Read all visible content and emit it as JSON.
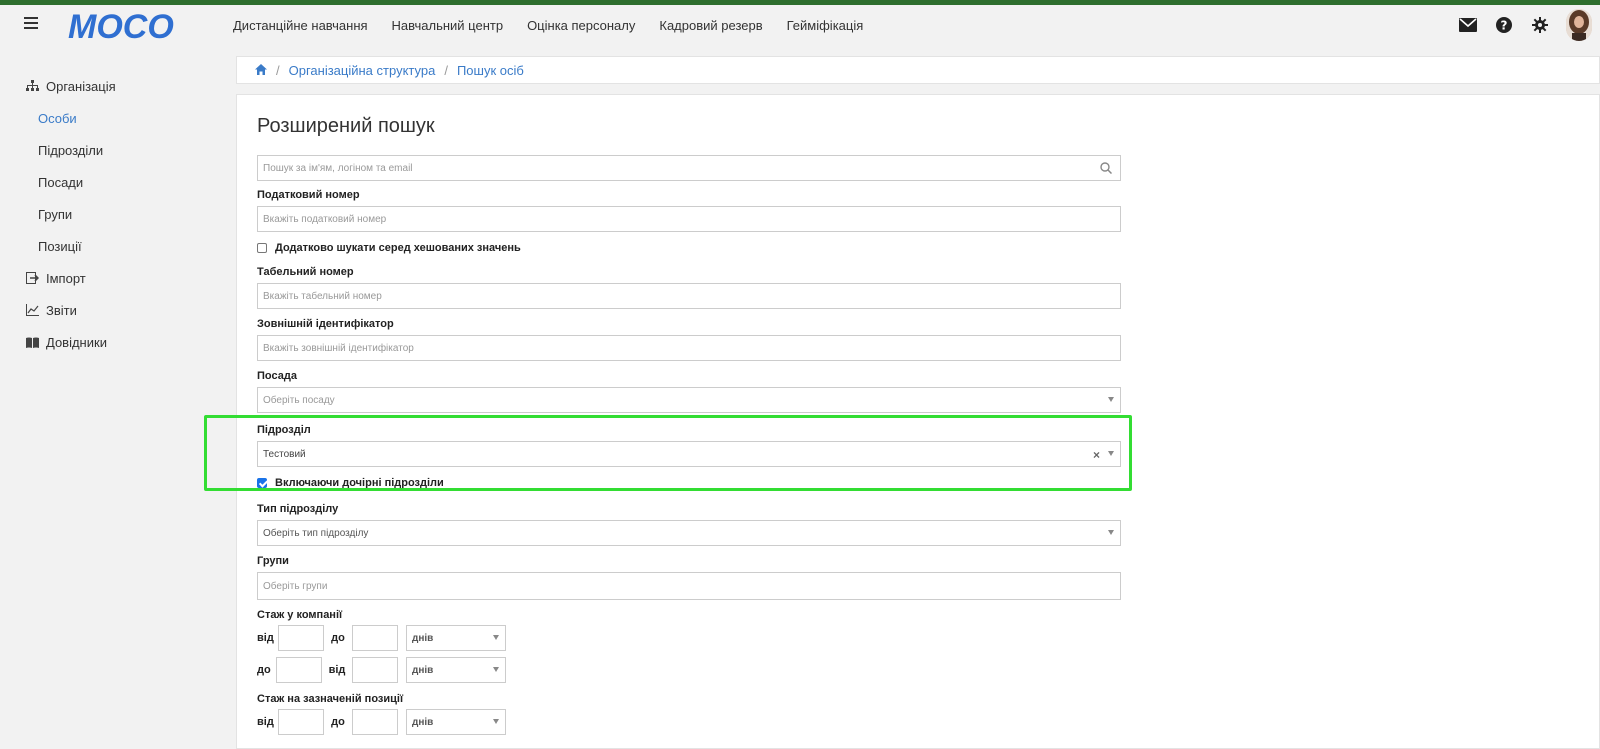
{
  "app": {
    "logo_text": "MOCO",
    "brand_color": "#2f6fd1",
    "stripe_color": "#2e6e2e",
    "accent_color": "#3a7bc8"
  },
  "topnav": {
    "items": [
      "Дистанційне навчання",
      "Навчальний центр",
      "Оцінка персоналу",
      "Кадровий резерв",
      "Гейміфікація"
    ]
  },
  "topicons": [
    "mail-icon",
    "help-icon",
    "gear-icon",
    "avatar"
  ],
  "sidebar": {
    "items": [
      {
        "label": "Організація",
        "icon": "org-chart-icon"
      },
      {
        "label": "Особи",
        "active": true
      },
      {
        "label": "Підрозділи"
      },
      {
        "label": "Посади"
      },
      {
        "label": "Групи"
      },
      {
        "label": "Позиції"
      },
      {
        "label": "Імпорт",
        "icon": "import-icon"
      },
      {
        "label": "Звіти",
        "icon": "reports-icon"
      },
      {
        "label": "Довідники",
        "icon": "book-icon"
      }
    ]
  },
  "breadcrumb": {
    "home_icon": "home-icon",
    "items": [
      "Організаційна структура",
      "Пошук осіб"
    ]
  },
  "page": {
    "title": "Розширений пошук"
  },
  "form": {
    "search": {
      "placeholder": "Пошук за ім'ям, логіном та email"
    },
    "tax": {
      "label": "Податковий номер",
      "placeholder": "Вкажіть податковий номер"
    },
    "hashed": {
      "label": "Додатково шукати серед хешованих значень",
      "checked": false
    },
    "tab": {
      "label": "Табельний номер",
      "placeholder": "Вкажіть табельний номер"
    },
    "external": {
      "label": "Зовнішній ідентифікатор",
      "placeholder": "Вкажіть зовнішній ідентифікатор"
    },
    "position": {
      "label": "Посада",
      "placeholder": "Оберіть посаду"
    },
    "unit": {
      "label": "Підрозділ",
      "value": "Тестовий",
      "clear": "×"
    },
    "include_children": {
      "label": "Включаючи дочірні підрозділи",
      "checked": true
    },
    "unit_type": {
      "label": "Тип підрозділу",
      "placeholder": "Оберіть тип підрозділу"
    },
    "groups": {
      "label": "Групи",
      "placeholder": "Оберіть групи"
    },
    "company_tenure": {
      "label": "Стаж у компанії",
      "row1": {
        "from": "від",
        "to": "до",
        "unit": "днів"
      },
      "row2": {
        "from": "до",
        "to": "від",
        "unit": "днів"
      }
    },
    "position_tenure": {
      "label": "Стаж на зазначеній позиції",
      "row1": {
        "from": "від",
        "to": "до",
        "unit": "днів"
      }
    }
  },
  "highlight_color": "#33dd33"
}
